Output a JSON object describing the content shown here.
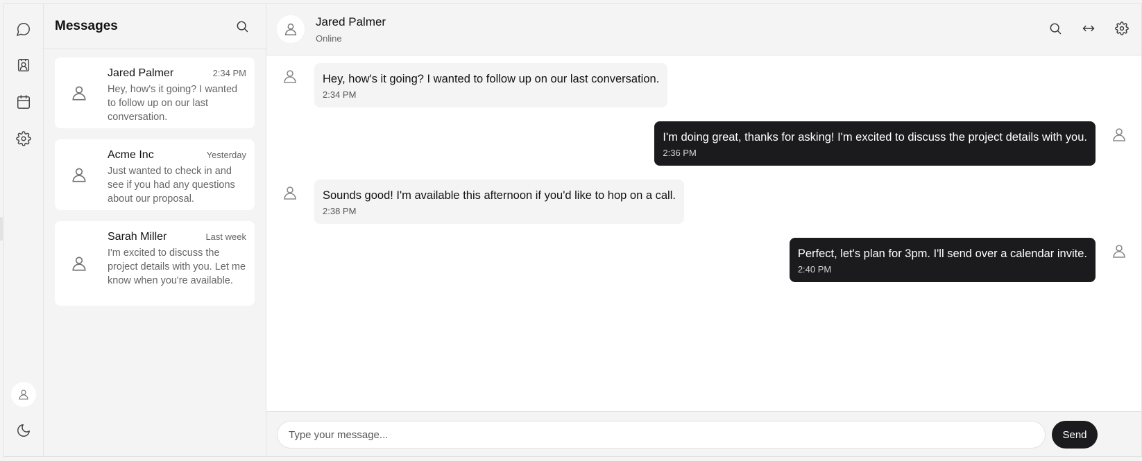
{
  "rail": {
    "items": [
      {
        "icon": "chat-bubble-icon"
      },
      {
        "icon": "contact-card-icon"
      },
      {
        "icon": "calendar-icon"
      },
      {
        "icon": "gear-icon"
      }
    ],
    "bottom": [
      {
        "icon": "user-icon"
      },
      {
        "icon": "moon-icon"
      }
    ]
  },
  "conversations": {
    "title": "Messages",
    "items": [
      {
        "name": "Jared Palmer",
        "time": "2:34 PM",
        "preview": "Hey, how's it going? I wanted to follow up on our last conversation."
      },
      {
        "name": "Acme Inc",
        "time": "Yesterday",
        "preview": "Just wanted to check in and see if you had any questions about our proposal."
      },
      {
        "name": "Sarah Miller",
        "time": "Last week",
        "preview": "I'm excited to discuss the project details with you. Let me know when you're available."
      }
    ]
  },
  "chat": {
    "contact_name": "Jared Palmer",
    "contact_status": "Online",
    "actions": [
      {
        "icon": "search-icon"
      },
      {
        "icon": "expand-horizontal-icon"
      },
      {
        "icon": "gear-icon"
      }
    ],
    "messages": [
      {
        "direction": "in",
        "text": "Hey, how's it going? I wanted to follow up on our last conversation.",
        "time": "2:34 PM"
      },
      {
        "direction": "out",
        "text": "I'm doing great, thanks for asking! I'm excited to discuss the project details with you.",
        "time": "2:36 PM"
      },
      {
        "direction": "in",
        "text": "Sounds good! I'm available this afternoon if you'd like to hop on a call.",
        "time": "2:38 PM"
      },
      {
        "direction": "out",
        "text": "Perfect, let's plan for 3pm. I'll send over a calendar invite.",
        "time": "2:40 PM"
      }
    ]
  },
  "composer": {
    "placeholder": "Type your message...",
    "value": "",
    "send_label": "Send"
  },
  "colors": {
    "panel_bg": "#f4f4f4",
    "border": "#e2e2e2",
    "outgoing_bubble": "#1b1b1d",
    "incoming_bubble": "#f4f4f4",
    "muted_text": "#666666"
  }
}
